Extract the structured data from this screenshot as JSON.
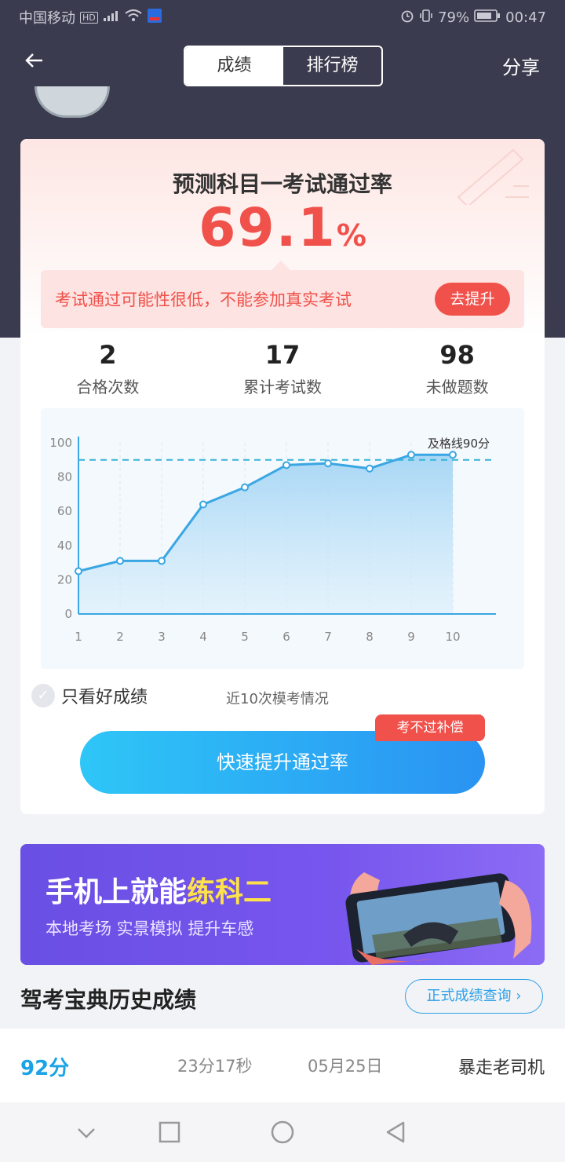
{
  "status_bar": {
    "carrier": "中国移动",
    "hd": "HD",
    "battery": "79%",
    "time": "00:47"
  },
  "nav": {
    "tabs": [
      "成绩",
      "排行榜"
    ],
    "active_tab": 0,
    "share": "分享"
  },
  "prediction": {
    "title": "预测科目一考试通过率",
    "rate": "69.1",
    "unit": "%",
    "warning": "考试通过可能性很低，不能参加真实考试",
    "improve_button": "去提升"
  },
  "stats": [
    {
      "value": "2",
      "label": "合格次数"
    },
    {
      "value": "17",
      "label": "累计考试数"
    },
    {
      "value": "98",
      "label": "未做题数"
    }
  ],
  "chart_data": {
    "type": "area",
    "x": [
      1,
      2,
      3,
      4,
      5,
      6,
      7,
      8,
      9,
      10
    ],
    "values": [
      25,
      31,
      31,
      64,
      74,
      87,
      88,
      85,
      93,
      93
    ],
    "ylim": [
      0,
      100
    ],
    "yticks": [
      0,
      20,
      40,
      60,
      80,
      100
    ],
    "threshold": 90,
    "threshold_label": "及格线90分",
    "line_color": "#3aa6e3",
    "threshold_color": "#36b3d6"
  },
  "filter": {
    "only_good_label": "只看好成绩",
    "recent_label": "近10次模考情况"
  },
  "cta": {
    "button_label": "快速提升通过率",
    "badge": "考不过补偿"
  },
  "banner": {
    "title_prefix": "手机上就能",
    "title_highlight": "练科二",
    "subtitle": "本地考场 实景模拟 提升车感"
  },
  "history": {
    "title": "驾考宝典历史成绩",
    "query_button": "正式成绩查询",
    "rows": [
      {
        "score": "92分",
        "duration": "23分17秒",
        "date": "05月25日",
        "user": "暴走老司机"
      }
    ]
  },
  "colors": {
    "accent_red": "#f0514b",
    "accent_blue": "#2a93f2",
    "header_bg": "#3a3b4e"
  }
}
